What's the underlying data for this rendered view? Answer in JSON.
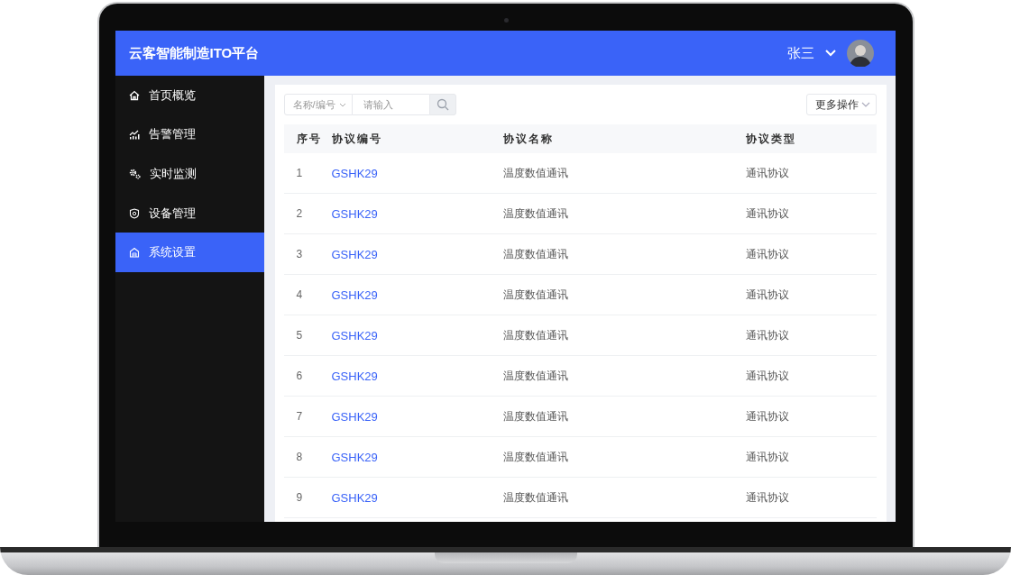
{
  "app": {
    "title": "云客智能制造ITO平台"
  },
  "user": {
    "name": "张三"
  },
  "sidebar": {
    "items": [
      {
        "label": "首页概览",
        "selected": false
      },
      {
        "label": "告警管理",
        "selected": false
      },
      {
        "label": "实时监测",
        "selected": false
      },
      {
        "label": "设备管理",
        "selected": false
      },
      {
        "label": "系统设置",
        "selected": true
      }
    ]
  },
  "search": {
    "category": "名称/编号",
    "placeholder": "请输入"
  },
  "more_button": "更多操作",
  "table": {
    "columns": [
      "序号",
      "协议编号",
      "协议名称",
      "协议类型"
    ],
    "rows": [
      {
        "index": "1",
        "code": "GSHK29",
        "name": "温度数值通讯",
        "type": "通讯协议"
      },
      {
        "index": "2",
        "code": "GSHK29",
        "name": "温度数值通讯",
        "type": "通讯协议"
      },
      {
        "index": "3",
        "code": "GSHK29",
        "name": "温度数值通讯",
        "type": "通讯协议"
      },
      {
        "index": "4",
        "code": "GSHK29",
        "name": "温度数值通讯",
        "type": "通讯协议"
      },
      {
        "index": "5",
        "code": "GSHK29",
        "name": "温度数值通讯",
        "type": "通讯协议"
      },
      {
        "index": "6",
        "code": "GSHK29",
        "name": "温度数值通讯",
        "type": "通讯协议"
      },
      {
        "index": "7",
        "code": "GSHK29",
        "name": "温度数值通讯",
        "type": "通讯协议"
      },
      {
        "index": "8",
        "code": "GSHK29",
        "name": "温度数值通讯",
        "type": "通讯协议"
      },
      {
        "index": "9",
        "code": "GSHK29",
        "name": "温度数值通讯",
        "type": "通讯协议"
      }
    ]
  }
}
